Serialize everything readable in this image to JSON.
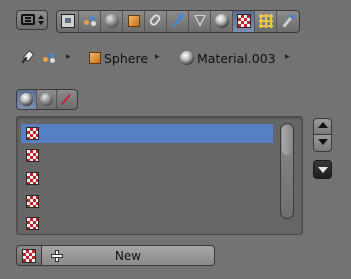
{
  "properties_tabs": [
    {
      "id": "render",
      "icon": "render-camera-icon",
      "active": false
    },
    {
      "id": "scene",
      "icon": "scene-icon",
      "active": false
    },
    {
      "id": "world",
      "icon": "world-icon",
      "active": false
    },
    {
      "id": "object",
      "icon": "object-cube-icon",
      "active": false
    },
    {
      "id": "constraints",
      "icon": "constraint-link-icon",
      "active": false
    },
    {
      "id": "modifiers",
      "icon": "wrench-icon",
      "active": false
    },
    {
      "id": "data",
      "icon": "mesh-data-icon",
      "active": false
    },
    {
      "id": "material",
      "icon": "material-sphere-icon",
      "active": false
    },
    {
      "id": "texture",
      "icon": "texture-checker-icon",
      "active": true
    },
    {
      "id": "particles",
      "icon": "particles-icon",
      "active": false
    },
    {
      "id": "physics",
      "icon": "physics-icon",
      "active": false
    }
  ],
  "breadcrumb": {
    "object": "Sphere",
    "material": "Material.003"
  },
  "context_tabs": [
    {
      "id": "world",
      "icon": "world-texture-icon",
      "active": true
    },
    {
      "id": "material",
      "icon": "material-texture-icon",
      "active": false
    },
    {
      "id": "brush",
      "icon": "brush-texture-icon",
      "active": false
    }
  ],
  "texture_slots": [
    {
      "label": "",
      "selected": true
    },
    {
      "label": "",
      "selected": false
    },
    {
      "label": "",
      "selected": false
    },
    {
      "label": "",
      "selected": false
    },
    {
      "label": "",
      "selected": false
    },
    {
      "label": "",
      "selected": false
    }
  ],
  "new_button": {
    "label": "New"
  },
  "colors": {
    "panel_bg": "#737373",
    "selected_row": "#5680c2",
    "active_tab": "#6a7ea0"
  }
}
